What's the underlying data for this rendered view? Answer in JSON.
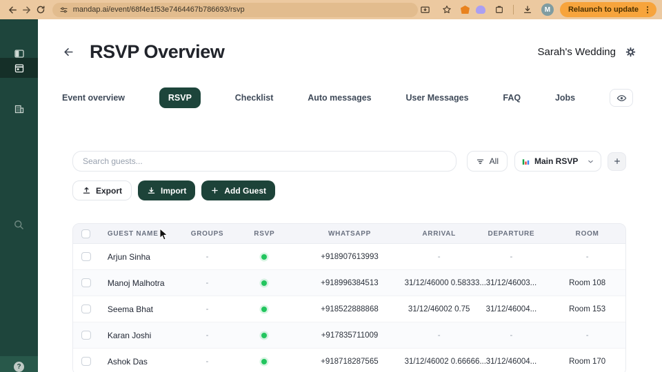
{
  "browser": {
    "url": "mandap.ai/event/68f4e1f53e7464467b786693/rsvp",
    "relaunch_label": "Relaunch to update",
    "avatar_initial": "M"
  },
  "header": {
    "title": "RSVP Overview",
    "event_name": "Sarah's Wedding"
  },
  "tabs": [
    {
      "label": "Event overview",
      "active": false
    },
    {
      "label": "RSVP",
      "active": true
    },
    {
      "label": "Checklist",
      "active": false
    },
    {
      "label": "Auto messages",
      "active": false
    },
    {
      "label": "User Messages",
      "active": false
    },
    {
      "label": "FAQ",
      "active": false
    },
    {
      "label": "Jobs",
      "active": false
    }
  ],
  "toolbar": {
    "search_placeholder": "Search guests...",
    "filter_all_label": "All",
    "view_select_value": "Main RSVP",
    "plus_label": "+",
    "export_label": "Export",
    "import_label": "Import",
    "add_guest_label": "Add Guest"
  },
  "table": {
    "columns": [
      "GUEST NAME",
      "GROUPS",
      "RSVP",
      "WHATSAPP",
      "ARRIVAL",
      "DEPARTURE",
      "ROOM"
    ],
    "rows": [
      {
        "name": "Arjun Sinha",
        "groups": "-",
        "rsvp": "green",
        "whatsapp": "+918907613993",
        "arrival": "-",
        "departure": "-",
        "room": "-"
      },
      {
        "name": "Manoj Malhotra",
        "groups": "-",
        "rsvp": "green",
        "whatsapp": "+918996384513",
        "arrival": "31/12/46000 0.58333...",
        "departure": "31/12/46003...",
        "room": "Room 108"
      },
      {
        "name": "Seema Bhat",
        "groups": "-",
        "rsvp": "green",
        "whatsapp": "+918522888868",
        "arrival": "31/12/46002 0.75",
        "departure": "31/12/46004...",
        "room": "Room 153"
      },
      {
        "name": "Karan Joshi",
        "groups": "-",
        "rsvp": "green",
        "whatsapp": "+917835711009",
        "arrival": "-",
        "departure": "-",
        "room": "-"
      },
      {
        "name": "Ashok Das",
        "groups": "-",
        "rsvp": "green",
        "whatsapp": "+918718287565",
        "arrival": "31/12/46002 0.66666...",
        "departure": "31/12/46004...",
        "room": "Room 170"
      }
    ]
  },
  "icons": {
    "sidebar": [
      "panel-toggle-icon",
      "calendar-icon",
      "building-icon",
      "search-icon",
      "logout-icon",
      "help-icon"
    ],
    "browser": [
      "back-icon",
      "forward-icon",
      "reload-icon",
      "site-settings-icon",
      "install-icon",
      "star-icon",
      "metamask-icon",
      "phantom-icon",
      "extensions-icon",
      "downloads-icon",
      "kebab-menu-icon"
    ]
  },
  "colors": {
    "brand_green": "#1d4339",
    "sidebar_green": "#1e453c",
    "status_green": "#22c55e",
    "chrome_bar": "#ecc9a1",
    "relaunch_orange": "#f7a43c"
  }
}
